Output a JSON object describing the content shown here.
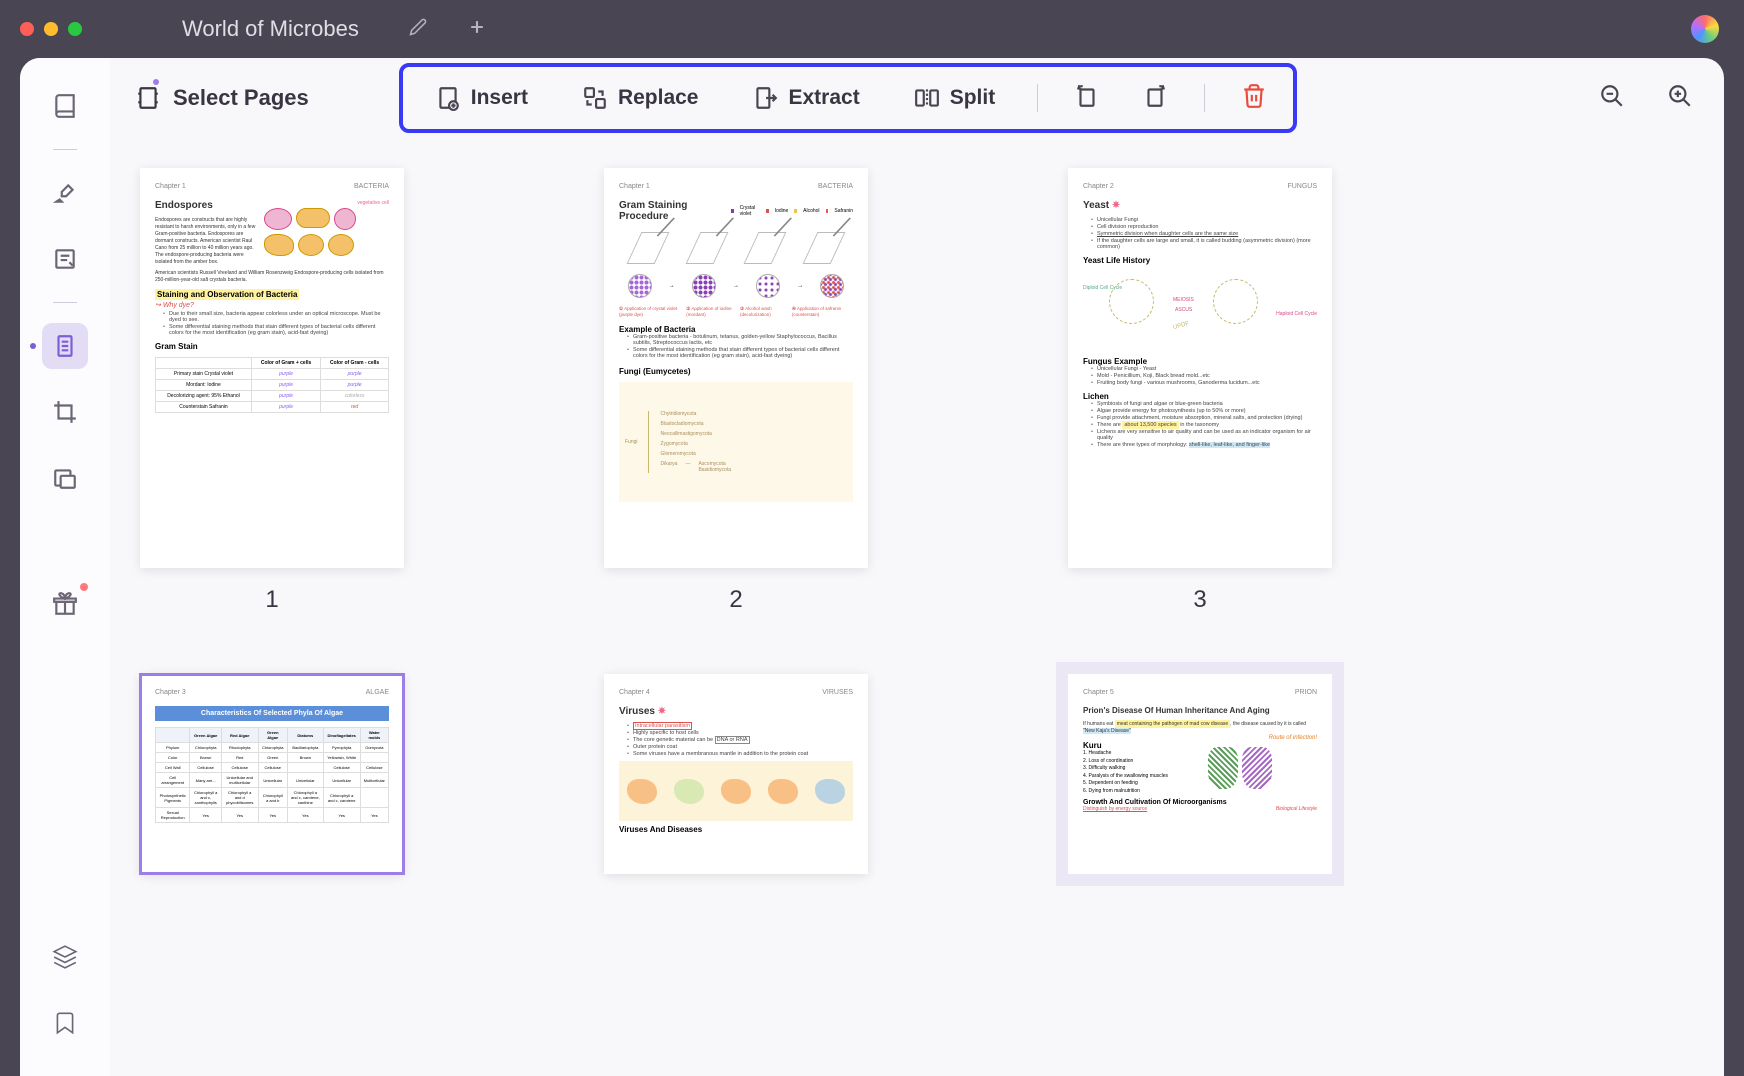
{
  "titlebar": {
    "document_title": "World of Microbes"
  },
  "toolbar": {
    "select_pages_label": "Select Pages",
    "insert_label": "Insert",
    "replace_label": "Replace",
    "extract_label": "Extract",
    "split_label": "Split"
  },
  "pages": {
    "p1": {
      "number": "1",
      "chapter": "Chapter 1",
      "category": "BACTERIA",
      "title": "Endospores",
      "intro": "Endospores are constructs that are highly resistant to harsh environments, only in a few Gram-positive bacteria. Endospores are dormant constructs. American scientist Raul Cano from 25 million to 40 million years ago. The endospore-producing bacteria were isolated from the amber box.",
      "intro2": "American scientists Russell Vreeland and William Rosenzweig Endospore-producing cells isolated from 250-million-year-old salt crystals bacteria.",
      "staining_title": "Staining and Observation of Bacteria",
      "why_dye": "Why dye?",
      "bullet1": "Due to their small size, bacteria appear colorless under an optical microscope. Must be dyed to see.",
      "bullet2": "Some differential staining methods that stain different types of bacterial cells different colors for the most identification (eg gram stain), acid-fast dyeing)",
      "gram_title": "Gram Stain",
      "table": {
        "h1": "Color of Gram + cells",
        "h2": "Color of Gram - cells",
        "r1": "Primary stain Crystal violet",
        "r2": "Mordant: Iodine",
        "r3": "Decolorizing agent: 95% Ethanol",
        "r4": "Counterstain Safranin",
        "purple": "purple",
        "colorless": "colorless",
        "red": "red"
      }
    },
    "p2": {
      "number": "2",
      "chapter": "Chapter 1",
      "category": "BACTERIA",
      "title": "Gram Staining Procedure",
      "legend": {
        "cv": "Crystal violet",
        "io": "Iodine",
        "al": "Alcohol",
        "sa": "Safranin"
      },
      "step1": "Application of crystal violet (purple dye)",
      "step2": "Application of iodine (mordant)",
      "step3": "Alcohol wash (decolorization)",
      "step4": "Application of safranin (counterstain)",
      "example_title": "Example of Bacteria",
      "ex_bullet1": "Gram-positive bacteria - botulinum, tetanus, golden-yellow Staphylococcus, Bacillus subtilis, Streptococcus lactis, etc",
      "ex_bullet2": "Some differential staining methods that stain different types of bacterial cells different colors for the most identification (eg gram stain), acid-fast dyeing)",
      "fungi_title": "Fungi (Eumycetes)",
      "branches": [
        "Chytridiomycota",
        "Blastocladiomycota",
        "Neocallimastigomycota",
        "Zygomycota",
        "Glomeromycota",
        "Ascomycota",
        "Basidiomycota"
      ],
      "dikarya": "Dikarya",
      "fungi_root": "Fungi"
    },
    "p3": {
      "number": "3",
      "chapter": "Chapter 2",
      "category": "FUNGUS",
      "title": "Yeast",
      "bullets": [
        "Unicellular Fungi",
        "Cell division reproduction",
        "Symmetric division when daughter cells are the same size",
        "If the daughter cells are large and small, it is called budding (asymmetric division) (more common)"
      ],
      "life_history_title": "Yeast Life History",
      "diag_labels": {
        "dip": "Diploid Cell Cycle",
        "hap": "Haploid Cell Cycle",
        "meiosis": "MEIOSIS",
        "ascus": "ASCUS",
        "updf": "UPDF"
      },
      "fungus_ex_title": "Fungus Example",
      "fungus_bullets": [
        "Unicellular Fungi - Yeast",
        "Mold - Penicillium, Koji, Black bread mold...etc",
        "Fruiting body fungi - various mushrooms, Ganoderma lucidum...etc"
      ],
      "lichen_title": "Lichen",
      "lichen_bullets": [
        "Symbiosis of fungi and algae or blue-green bacteria",
        "Algae provide energy for photosynthesis (up to 50% or more)",
        "Fungi provide attachment, moisture absorption, mineral salts, and protection (drying)",
        "There are about 13,500 species in the taxonomy",
        "Lichens are very sensitive to air quality and can be used as an indicator organism for air quality",
        "There are three types of morphology: shell-like, leaf-like, and finger-like"
      ],
      "about_species": "about 13,500 species",
      "morphology": "shell-like, leaf-like, and finger-like"
    },
    "p4": {
      "chapter": "Chapter 3",
      "category": "ALGAE",
      "table_title": "Characteristics Of Selected Phyla Of Algae",
      "headers": [
        "",
        "Green Algae",
        "Red Algae",
        "Green Algae",
        "Diatoms",
        "Dinoflagellates",
        "Water molds"
      ],
      "rows": [
        [
          "Phylum",
          "Chlorophyta",
          "Rhodophyta",
          "Chlorophyta",
          "Bacillariophyta",
          "Pyrrophyta",
          "Oomycota"
        ],
        [
          "Color",
          "Brown",
          "Red",
          "Green",
          "Brown",
          "Yellowish, White",
          ""
        ],
        [
          "Cell Wall",
          "Cellulose",
          "Cellulose",
          "Cellulose",
          "",
          "Cellulose",
          "Cellulose"
        ],
        [
          "Cell arrangement",
          "Many are...",
          "Unicellular and multicellular",
          "Unicellular",
          "Unicellular",
          "Unicellular",
          "Multicellular"
        ],
        [
          "Photosynthetic Pigments",
          "Chlorophyll a and c, xanthophylls",
          "Chlorophyll a and d phycobilisomes",
          "Chlorophyll a and b",
          "Chlorophyll a and c, carotene, xanthine",
          "Chlorophyll a and c, carotene",
          ""
        ],
        [
          "Sexual Reproduction",
          "Yes",
          "Yes",
          "Yes",
          "Yes",
          "Yes",
          "Yes"
        ]
      ]
    },
    "p5": {
      "chapter": "Chapter 4",
      "category": "VIRUSES",
      "title": "Viruses",
      "bullets": [
        "Intracellular parasitism",
        "Highly specific to host cells",
        "The core genetic material can be DNA or RNA",
        "Outer protein coat",
        "Some viruses have a membranous mantle in addition to the protein coat"
      ],
      "hlred": "Intracellular parasitism",
      "hl_dna": "DNA or RNA",
      "vd_title": "Viruses And Diseases"
    },
    "p6": {
      "chapter": "Chapter 5",
      "category": "PRION",
      "title": "Prion's Disease Of Human Inheritance And Aging",
      "intro": "If humans eat meat containing the pathogen of mad cow disease, the disease caused by it is called \"New Kaja's Disease\"",
      "hl1": "meat containing the pathogen of mad cow disease",
      "hl2": "\"New Kaja's Disease\"",
      "route": "Route of infection!",
      "kuru_title": "Kuru",
      "kuru_list": [
        "1. Headache",
        "2. Loss of coordination",
        "3. Difficulty walking",
        "4. Paralysis of the swallowing muscles",
        "5. Dependent on feeding",
        "6. Dying from malnutrition"
      ],
      "growth_title": "Growth And Cultivation Of Microorganisms",
      "distinguish": "Distinguish by energy source",
      "biological": "Biological Lifestyle"
    }
  }
}
